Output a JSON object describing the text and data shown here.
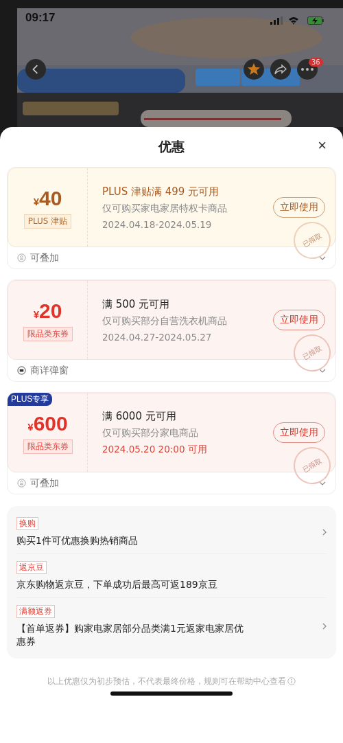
{
  "status_bar": {
    "time": "09:17"
  },
  "header": {
    "cart_count": "36"
  },
  "sheet": {
    "title": "优惠",
    "close": "×"
  },
  "coupons": [
    {
      "kind": "gold",
      "currency": "¥",
      "amount": "40",
      "tag": "PLUS 津贴",
      "title": "PLUS 津贴满 499 元可用",
      "desc": "仅可购买家电家居特权卡商品",
      "date": "2024.04.18-2024.05.19",
      "date_highlight": false,
      "button": "立即使用",
      "stamp": "已领取",
      "note": {
        "kind": "stack",
        "text": "可叠加"
      }
    },
    {
      "kind": "red",
      "currency": "¥",
      "amount": "20",
      "tag": "限品类东券",
      "title": "满 500 元可用",
      "desc": "仅可购买部分自营洗衣机商品",
      "date": "2024.04.27-2024.05.27",
      "date_highlight": false,
      "button": "立即使用",
      "stamp": "已领取",
      "note": {
        "kind": "popup",
        "text": "商详弹窗"
      }
    },
    {
      "kind": "red",
      "badge": "PLUS专享",
      "currency": "¥",
      "amount": "600",
      "tag": "限品类东券",
      "title": "满 6000 元可用",
      "desc": "仅可购买部分家电商品",
      "date": "2024.05.20 20:00 可用",
      "date_highlight": true,
      "button": "立即使用",
      "stamp": "已领取",
      "note": {
        "kind": "stack",
        "text": "可叠加"
      }
    }
  ],
  "promotions": [
    {
      "tag": "换购",
      "text": "购买1件可优惠换购热销商品",
      "arrow": true
    },
    {
      "tag": "返京豆",
      "text": "京东购物返京豆，下单成功后最高可返189京豆",
      "arrow": false
    },
    {
      "tag": "满额返券",
      "text": "【首单返券】购家电家居部分品类满1元返家电家居优惠券",
      "arrow": true
    }
  ],
  "footer": "以上优惠仅为初步预估，不代表最终价格，规则可在帮助中心查看"
}
